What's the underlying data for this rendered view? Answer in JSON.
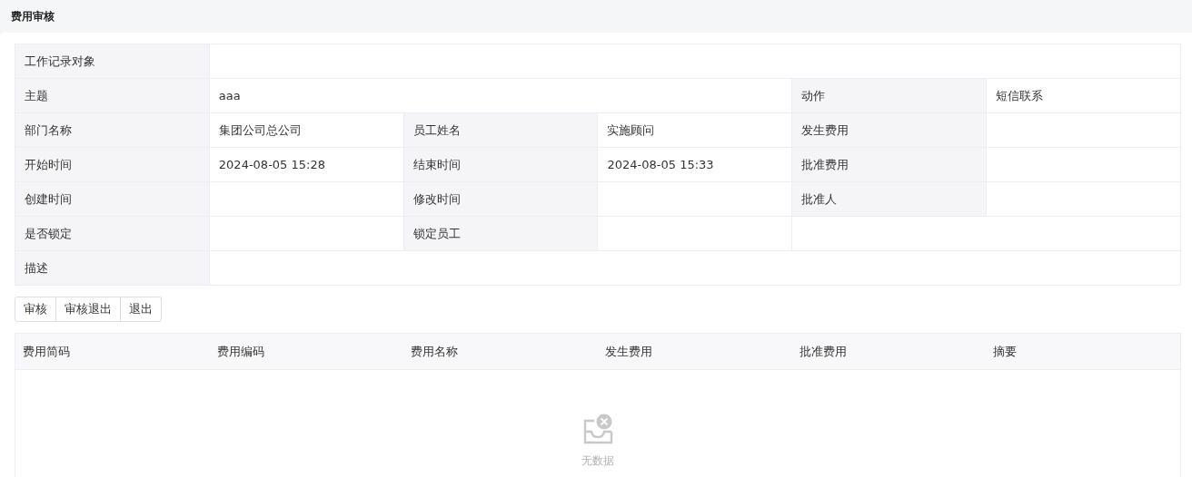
{
  "page": {
    "title": "费用审核"
  },
  "details": {
    "rows": [
      [
        {
          "kind": "label",
          "text": "工作记录对象"
        },
        {
          "kind": "value"
        },
        {
          "kind": "merged"
        },
        {
          "kind": "merged"
        },
        {
          "kind": "merged"
        },
        {
          "kind": "merged"
        }
      ],
      [
        {
          "kind": "label",
          "text": "主题"
        },
        {
          "kind": "value",
          "text": "aaa"
        },
        {
          "kind": "merged"
        },
        {
          "kind": "merged"
        },
        {
          "kind": "label",
          "text": "动作"
        },
        {
          "kind": "value",
          "text": "短信联系"
        }
      ],
      [
        {
          "kind": "label",
          "text": "部门名称"
        },
        {
          "kind": "value",
          "text": "集团公司总公司"
        },
        {
          "kind": "label",
          "text": "员工姓名"
        },
        {
          "kind": "value",
          "text": "实施顾问"
        },
        {
          "kind": "label",
          "text": "发生费用"
        },
        {
          "kind": "value"
        }
      ],
      [
        {
          "kind": "label",
          "text": "开始时间"
        },
        {
          "kind": "value",
          "text": "2024-08-05 15:28"
        },
        {
          "kind": "label",
          "text": "结束时间"
        },
        {
          "kind": "value",
          "text": "2024-08-05 15:33"
        },
        {
          "kind": "label",
          "text": "批准费用"
        },
        {
          "kind": "value"
        }
      ],
      [
        {
          "kind": "label",
          "text": "创建时间"
        },
        {
          "kind": "value"
        },
        {
          "kind": "label",
          "text": "修改时间"
        },
        {
          "kind": "value"
        },
        {
          "kind": "label",
          "text": "批准人"
        },
        {
          "kind": "value"
        }
      ],
      [
        {
          "kind": "label",
          "text": "是否锁定"
        },
        {
          "kind": "value"
        },
        {
          "kind": "label",
          "text": "锁定员工"
        },
        {
          "kind": "value"
        },
        {
          "kind": "value"
        },
        {
          "kind": "merged"
        }
      ],
      [
        {
          "kind": "label",
          "text": "描述"
        },
        {
          "kind": "value"
        },
        {
          "kind": "merged"
        },
        {
          "kind": "merged"
        },
        {
          "kind": "merged"
        },
        {
          "kind": "merged"
        }
      ]
    ]
  },
  "buttons": [
    "审核",
    "审核退出",
    "退出"
  ],
  "table": {
    "columns": [
      "费用简码",
      "费用编码",
      "费用名称",
      "发生费用",
      "批准费用",
      "摘要"
    ],
    "empty_text": "无数据"
  }
}
